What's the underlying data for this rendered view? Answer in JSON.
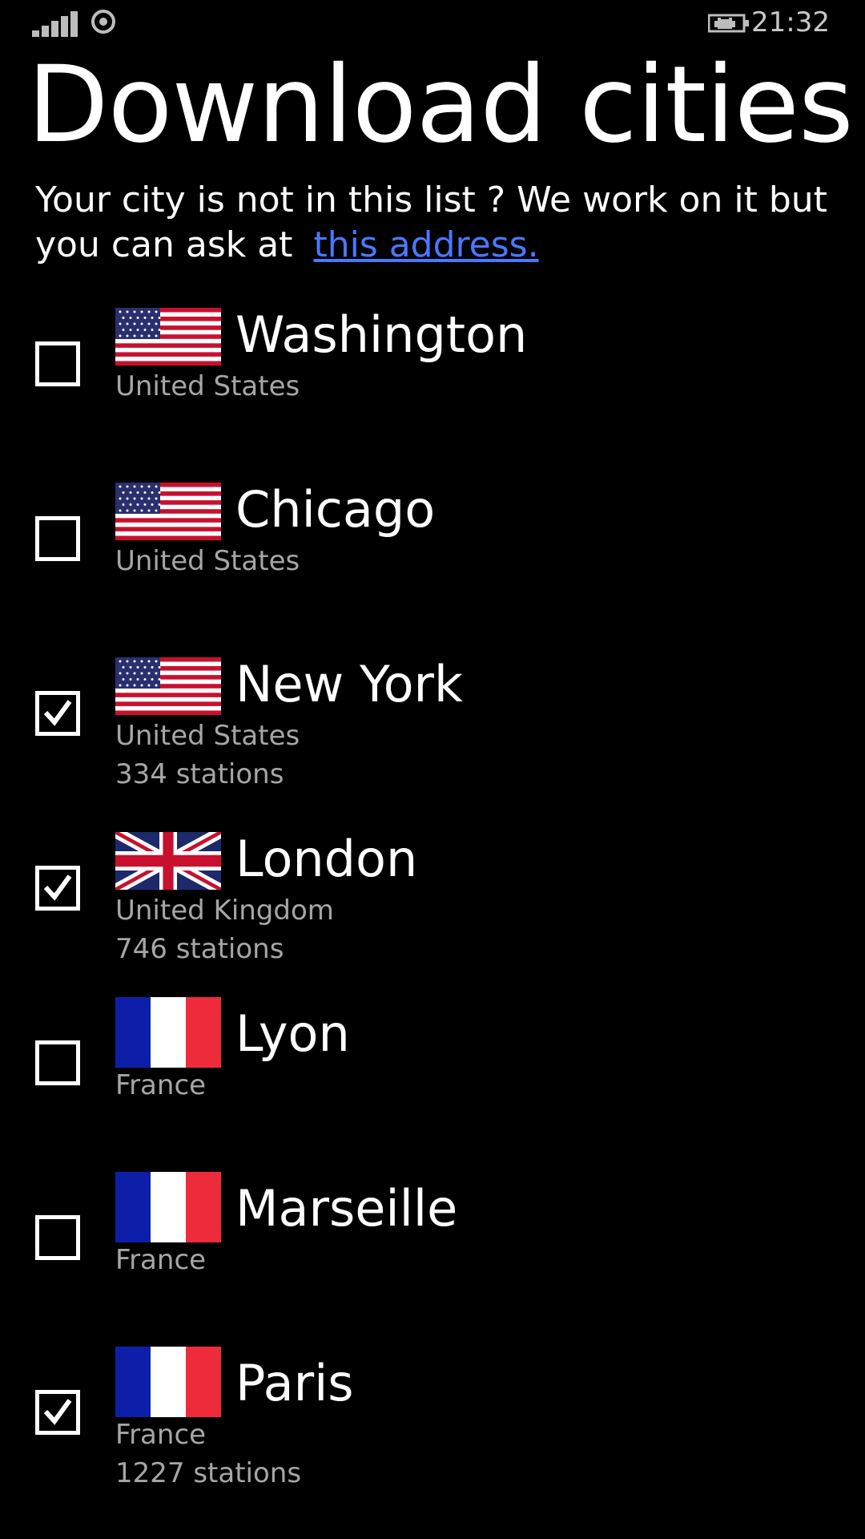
{
  "status_bar": {
    "time": "21:32"
  },
  "page": {
    "title": "Download cities",
    "intro_text": "Your city is not in this list ? We work on it but you can ask at",
    "intro_link": "this address.",
    "link_color": "#4a78ff"
  },
  "cities": [
    {
      "name": "Washington",
      "country": "United States",
      "flag": "us-flag-icon",
      "checked": false,
      "stations": ""
    },
    {
      "name": "Chicago",
      "country": "United States",
      "flag": "us-flag-icon",
      "checked": false,
      "stations": ""
    },
    {
      "name": "New York",
      "country": "United States",
      "flag": "us-flag-icon",
      "checked": true,
      "stations": "334 stations"
    },
    {
      "name": "London",
      "country": "United Kingdom",
      "flag": "uk-flag-icon",
      "checked": true,
      "stations": "746 stations"
    },
    {
      "name": "Lyon",
      "country": "France",
      "flag": "fr-flag-icon",
      "checked": false,
      "stations": ""
    },
    {
      "name": "Marseille",
      "country": "France",
      "flag": "fr-flag-icon",
      "checked": false,
      "stations": ""
    },
    {
      "name": "Paris",
      "country": "France",
      "flag": "fr-flag-icon",
      "checked": true,
      "stations": "1227 stations"
    }
  ]
}
